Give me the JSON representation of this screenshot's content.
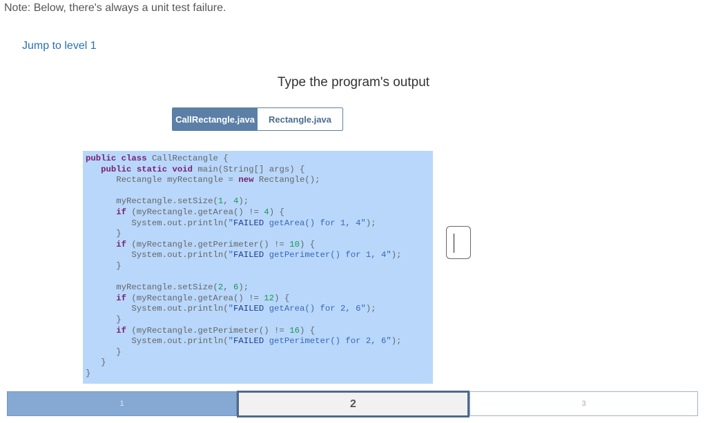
{
  "note": "Note: Below, there's always a unit test failure.",
  "jump_link": "Jump to level 1",
  "prompt": "Type the program's output",
  "tabs": [
    {
      "label": "CallRectangle.java",
      "active": true
    },
    {
      "label": "Rectangle.java",
      "active": false
    }
  ],
  "code": {
    "lines": [
      "public class CallRectangle {",
      "   public static void main(String[] args) {",
      "      Rectangle myRectangle = new Rectangle();",
      "",
      "      myRectangle.setSize(1, 4);",
      "      if (myRectangle.getArea() != 4) {",
      "         System.out.println(\"FAILED getArea() for 1, 4\");",
      "      }",
      "      if (myRectangle.getPerimeter() != 10) {",
      "         System.out.println(\"FAILED getPerimeter() for 1, 4\");",
      "      }",
      "",
      "      myRectangle.setSize(2, 6);",
      "      if (myRectangle.getArea() != 12) {",
      "         System.out.println(\"FAILED getArea() for 2, 6\");",
      "      }",
      "      if (myRectangle.getPerimeter() != 16) {",
      "         System.out.println(\"FAILED getPerimeter() for 2, 6\");",
      "      }",
      "   }",
      "}"
    ]
  },
  "answer_input": {
    "value": ""
  },
  "progress": {
    "levels": [
      "1",
      "2",
      "3"
    ],
    "current": "2"
  },
  "colors": {
    "code_background": "#b8d7fb",
    "tab_active": "#5b7fa6",
    "keyword": "#7a1f6e",
    "number": "#1a9a4a",
    "link": "#2a6fb0"
  }
}
